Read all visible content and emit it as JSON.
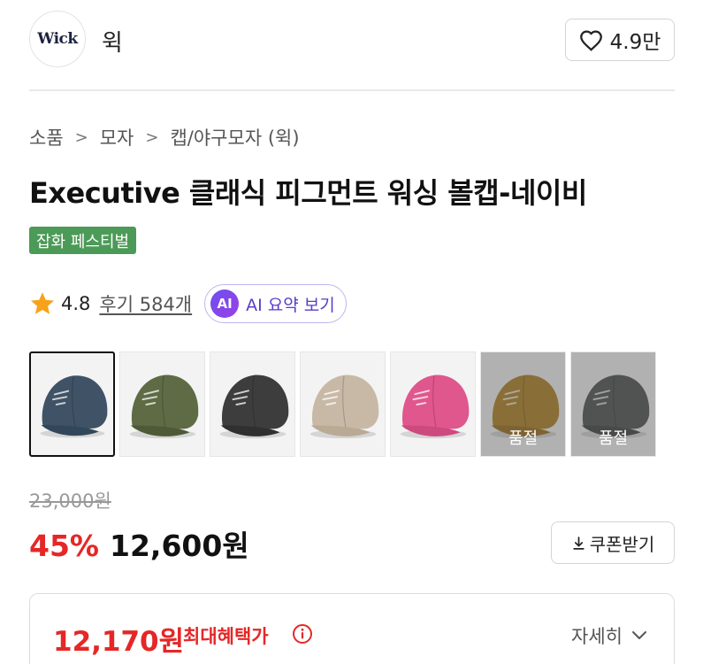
{
  "brand": {
    "logo_text": "Wick",
    "name": "윅"
  },
  "like": {
    "count": "4.9만",
    "icon": "heart-outline-icon"
  },
  "breadcrumb": [
    "소품",
    "모자",
    "캡/야구모자 (윅)"
  ],
  "breadcrumb_separator": ">",
  "product": {
    "title": "Executive 클래식 피그먼트 워싱 볼캡-네이비",
    "badge": "잡화 페스티벌",
    "rating": "4.8",
    "review_link": "후기 584개",
    "ai_button": {
      "icon_text": "AI",
      "label": "AI 요약 보기"
    }
  },
  "thumbnails": [
    {
      "color_name": "navy",
      "cap_color": "#3f5266",
      "brim_color": "#33475a",
      "selected": true,
      "sold_out": false
    },
    {
      "color_name": "olive",
      "cap_color": "#5e6b44",
      "brim_color": "#4e5a37",
      "selected": false,
      "sold_out": false
    },
    {
      "color_name": "charcoal",
      "cap_color": "#3c3d3c",
      "brim_color": "#2f302f",
      "selected": false,
      "sold_out": false
    },
    {
      "color_name": "beige",
      "cap_color": "#c8b9a6",
      "brim_color": "#b9aa96",
      "selected": false,
      "sold_out": false
    },
    {
      "color_name": "pink",
      "cap_color": "#e0578d",
      "brim_color": "#cc4a7e",
      "selected": false,
      "sold_out": false
    },
    {
      "color_name": "mustard",
      "cap_color": "#b4872e",
      "brim_color": "#9e7526",
      "selected": false,
      "sold_out": true
    },
    {
      "color_name": "gray",
      "cap_color": "#58595a",
      "brim_color": "#4a4b4c",
      "selected": false,
      "sold_out": true
    }
  ],
  "sold_out_label": "품절",
  "pricing": {
    "original": "23,000원",
    "discount": "45%",
    "price": "12,600원",
    "coupon_button": "쿠폰받기"
  },
  "benefit": {
    "price": "12,170원",
    "label": "최대혜택가",
    "detail_link": "자세히"
  },
  "colors": {
    "accent_red": "#e52727",
    "badge_green": "#4c9a57",
    "ai_purple": "#5a3cc9",
    "star": "#f7a21b"
  }
}
